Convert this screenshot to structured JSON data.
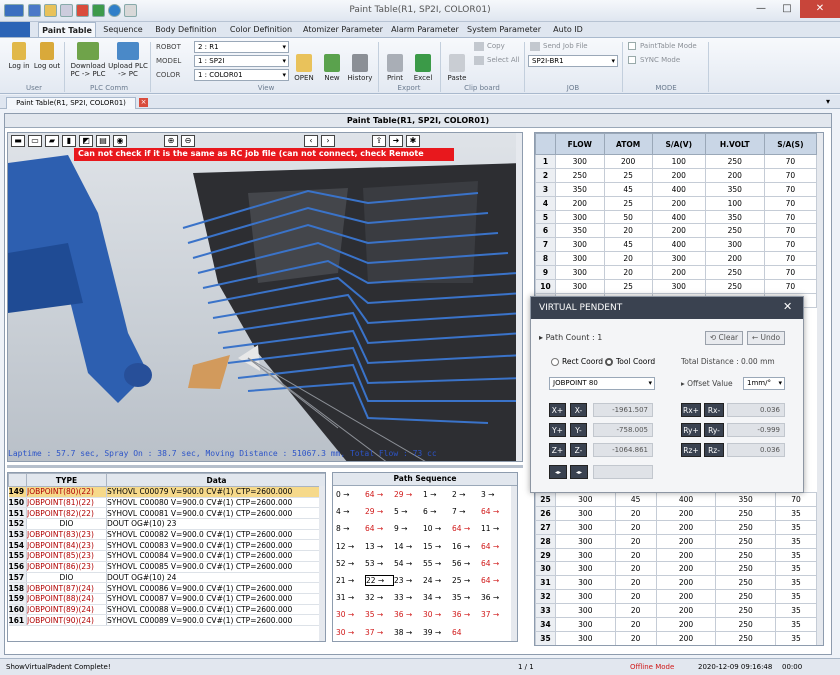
{
  "window": {
    "title": "Paint Table(R1, SP2I, COLOR01)",
    "controls": [
      "—",
      "□",
      "✕"
    ]
  },
  "tabs": [
    "Paint Table",
    "Sequence",
    "Body Definition",
    "Color Definition",
    "Atomizer Parameter",
    "Alarm Parameter",
    "System Parameter",
    "Auto ID"
  ],
  "ribbon": {
    "user": {
      "group": "User",
      "login": "Log in",
      "logout": "Log out"
    },
    "plc": {
      "group": "PLC Comm",
      "download": "Download PC -> PLC",
      "upload": "Upload PLC -> PC"
    },
    "view": {
      "group": "View",
      "robot_label": "ROBOT",
      "robot_value": "2 : R1",
      "model_label": "MODEL",
      "model_value": "1 : SP2I",
      "color_label": "COLOR",
      "color_value": "1 : COLOR01",
      "open": "OPEN",
      "new": "New",
      "history": "History"
    },
    "export": {
      "group": "Export",
      "print": "Print",
      "excel": "Excel"
    },
    "clipboard": {
      "group": "Clip board",
      "paste": "Paste",
      "copy": "Copy",
      "select_all": "Select All"
    },
    "job": {
      "group": "JOB",
      "send_job": "Send Job File",
      "job_value": "SP2I-BR1"
    },
    "mode": {
      "group": "MODE",
      "painttable": "PaintTable Mode",
      "sync": "SYNC Mode"
    }
  },
  "doc_tab": "Paint Table(R1, SP2I, COLOR01)",
  "panel_title": "Paint Table(R1, SP2I, COLOR01)",
  "viewer": {
    "warning": "Can not check if it is the same as RC job file (can not connect, check Remote",
    "laptime": "Laptime : 57.7 sec, Spray On : 38.7 sec, Moving Distance : 51067.3 mm, Total Flow : 73 cc",
    "toolbar_icons": [
      "car-side-icon",
      "car-front-icon",
      "car-top-icon",
      "car-rear-icon",
      "car-iso-icon",
      "stack-icon",
      "eye-icon",
      "zoom-in-icon",
      "zoom-out-icon",
      "prev-icon",
      "next-icon",
      "export-icon",
      "arrow-icon",
      "settings-icon"
    ],
    "body_color": "#2e2f33",
    "robot_color": "#2d5fb0",
    "path_color": "#3a73c9"
  },
  "program": {
    "headers": [
      "",
      "TYPE",
      "Data"
    ],
    "rows": [
      {
        "n": "149",
        "type": "JOBPOINT(80)(22)",
        "data": "SYHOVL C00079 V=900.0 CV#(1) CTP=2600.000",
        "red": true
      },
      {
        "n": "150",
        "type": "JOBPOINT(81)(22)",
        "data": "SYHOVL C00080 V=900.0 CV#(1) CTP=2600.000",
        "red": true
      },
      {
        "n": "151",
        "type": "JOBPOINT(82)(22)",
        "data": "SYHOVL C00081 V=900.0 CV#(1) CTP=2600.000",
        "red": true
      },
      {
        "n": "152",
        "type": "DIO",
        "data": "DOUT OG#(10) 23",
        "red": false
      },
      {
        "n": "153",
        "type": "JOBPOINT(83)(23)",
        "data": "SYHOVL C00082 V=900.0 CV#(1) CTP=2600.000",
        "red": true
      },
      {
        "n": "154",
        "type": "JOBPOINT(84)(23)",
        "data": "SYHOVL C00083 V=900.0 CV#(1) CTP=2600.000",
        "red": true
      },
      {
        "n": "155",
        "type": "JOBPOINT(85)(23)",
        "data": "SYHOVL C00084 V=900.0 CV#(1) CTP=2600.000",
        "red": true
      },
      {
        "n": "156",
        "type": "JOBPOINT(86)(23)",
        "data": "SYHOVL C00085 V=900.0 CV#(1) CTP=2600.000",
        "red": true
      },
      {
        "n": "157",
        "type": "DIO",
        "data": "DOUT OG#(10) 24",
        "red": false
      },
      {
        "n": "158",
        "type": "JOBPOINT(87)(24)",
        "data": "SYHOVL C00086 V=900.0 CV#(1) CTP=2600.000",
        "red": true
      },
      {
        "n": "159",
        "type": "JOBPOINT(88)(24)",
        "data": "SYHOVL C00087 V=900.0 CV#(1) CTP=2600.000",
        "red": true
      },
      {
        "n": "160",
        "type": "JOBPOINT(89)(24)",
        "data": "SYHOVL C00088 V=900.0 CV#(1) CTP=2600.000",
        "red": true
      },
      {
        "n": "161",
        "type": "JOBPOINT(90)(24)",
        "data": "SYHOVL C00089 V=900.0 CV#(1) CTP=2600.000",
        "red": true
      }
    ]
  },
  "sequence": {
    "title": "Path Sequence",
    "rows": [
      [
        {
          "t": "0 →",
          "r": false
        },
        {
          "t": "64 →",
          "r": true
        },
        {
          "t": "29 →",
          "r": true
        },
        {
          "t": "1 →",
          "r": false
        },
        {
          "t": "2 →",
          "r": false
        },
        {
          "t": "3 →",
          "r": false
        }
      ],
      [
        {
          "t": "4 →",
          "r": false
        },
        {
          "t": "29 →",
          "r": true
        },
        {
          "t": "5 →",
          "r": false
        },
        {
          "t": "6 →",
          "r": false
        },
        {
          "t": "7 →",
          "r": false
        },
        {
          "t": "64 →",
          "r": true
        }
      ],
      [
        {
          "t": "8 →",
          "r": false
        },
        {
          "t": "64 →",
          "r": true
        },
        {
          "t": "9 →",
          "r": false
        },
        {
          "t": "10 →",
          "r": false
        },
        {
          "t": "64 →",
          "r": true
        },
        {
          "t": "11 →",
          "r": false
        }
      ],
      [
        {
          "t": "12 →",
          "r": false
        },
        {
          "t": "13 →",
          "r": false
        },
        {
          "t": "14 →",
          "r": false
        },
        {
          "t": "15 →",
          "r": false
        },
        {
          "t": "16 →",
          "r": false
        },
        {
          "t": "64 →",
          "r": true
        }
      ],
      [
        {
          "t": "52 →",
          "r": false
        },
        {
          "t": "53 →",
          "r": false
        },
        {
          "t": "54 →",
          "r": false
        },
        {
          "t": "55 →",
          "r": false
        },
        {
          "t": "56 →",
          "r": false
        },
        {
          "t": "64 →",
          "r": true
        }
      ],
      [
        {
          "t": "21 →",
          "r": false
        },
        {
          "t": "22 →",
          "r": false,
          "sel": true
        },
        {
          "t": "23 →",
          "r": false
        },
        {
          "t": "24 →",
          "r": false
        },
        {
          "t": "25 →",
          "r": false
        },
        {
          "t": "64 →",
          "r": true
        }
      ],
      [
        {
          "t": "31 →",
          "r": false
        },
        {
          "t": "32 →",
          "r": false
        },
        {
          "t": "33 →",
          "r": false
        },
        {
          "t": "34 →",
          "r": false
        },
        {
          "t": "35 →",
          "r": false
        },
        {
          "t": "36 →",
          "r": false
        }
      ],
      [
        {
          "t": "30 →",
          "r": true
        },
        {
          "t": "35 →",
          "r": true
        },
        {
          "t": "36 →",
          "r": true
        },
        {
          "t": "30 →",
          "r": true
        },
        {
          "t": "36 →",
          "r": true
        },
        {
          "t": "37 →",
          "r": true
        }
      ],
      [
        {
          "t": "30 →",
          "r": true
        },
        {
          "t": "37 →",
          "r": true
        },
        {
          "t": "38 →",
          "r": false
        },
        {
          "t": "39 →",
          "r": false
        },
        {
          "t": "64",
          "r": true
        },
        {
          "t": "",
          "r": false
        }
      ]
    ]
  },
  "params": {
    "headers": [
      "",
      "FLOW",
      "ATOM",
      "S/A(V)",
      "H.VOLT",
      "S/A(S)"
    ],
    "top_rows": [
      [
        "1",
        "300",
        "200",
        "100",
        "250",
        "70"
      ],
      [
        "2",
        "250",
        "25",
        "200",
        "200",
        "70"
      ],
      [
        "3",
        "350",
        "45",
        "400",
        "350",
        "70"
      ],
      [
        "4",
        "200",
        "25",
        "200",
        "100",
        "70"
      ],
      [
        "5",
        "300",
        "50",
        "400",
        "350",
        "70"
      ],
      [
        "6",
        "350",
        "20",
        "200",
        "250",
        "70"
      ],
      [
        "7",
        "300",
        "45",
        "400",
        "300",
        "70"
      ],
      [
        "8",
        "300",
        "20",
        "300",
        "200",
        "70"
      ],
      [
        "9",
        "300",
        "20",
        "200",
        "250",
        "70"
      ],
      [
        "10",
        "300",
        "25",
        "300",
        "250",
        "70"
      ],
      [
        "11",
        "300",
        "20",
        "200",
        "350",
        "70"
      ]
    ],
    "bottom_rows": [
      [
        "25",
        "300",
        "45",
        "400",
        "350",
        "70"
      ],
      [
        "26",
        "300",
        "20",
        "200",
        "250",
        "35"
      ],
      [
        "27",
        "300",
        "20",
        "200",
        "250",
        "35"
      ],
      [
        "28",
        "300",
        "20",
        "200",
        "250",
        "35"
      ],
      [
        "29",
        "300",
        "20",
        "200",
        "250",
        "35"
      ],
      [
        "30",
        "300",
        "20",
        "200",
        "250",
        "35"
      ],
      [
        "31",
        "300",
        "20",
        "200",
        "250",
        "35"
      ],
      [
        "32",
        "300",
        "20",
        "200",
        "250",
        "35"
      ],
      [
        "33",
        "300",
        "20",
        "200",
        "250",
        "35"
      ],
      [
        "34",
        "300",
        "20",
        "200",
        "250",
        "35"
      ],
      [
        "35",
        "300",
        "20",
        "200",
        "250",
        "35"
      ]
    ]
  },
  "pendent": {
    "title": "VIRTUAL PENDENT",
    "path_count": "Path Count : 1",
    "clear": "Clear",
    "undo": "Undo",
    "rect": "Rect Coord",
    "tool": "Tool Coord",
    "total": "Total Distance : 0.00 mm",
    "jobpoint": "JOBPOINT 80",
    "offset_label": "Offset Value",
    "offset_value": "1mm/°",
    "left": [
      {
        "p": "X+",
        "m": "X-",
        "v": "-1961.507"
      },
      {
        "p": "Y+",
        "m": "Y-",
        "v": "-758.005"
      },
      {
        "p": "Z+",
        "m": "Z-",
        "v": "-1064.861"
      }
    ],
    "right": [
      {
        "p": "Rx+",
        "m": "Rx-",
        "v": "0.036"
      },
      {
        "p": "Ry+",
        "m": "Ry-",
        "v": "-0.999"
      },
      {
        "p": "Rz+",
        "m": "Rz-",
        "v": "0.036"
      }
    ]
  },
  "status": {
    "message": "ShowVirtualPadent Complete!",
    "page": "1 / 1",
    "mode": "Offline Mode",
    "datetime": "2020-12-09 09:16:48",
    "time": "00:00"
  }
}
